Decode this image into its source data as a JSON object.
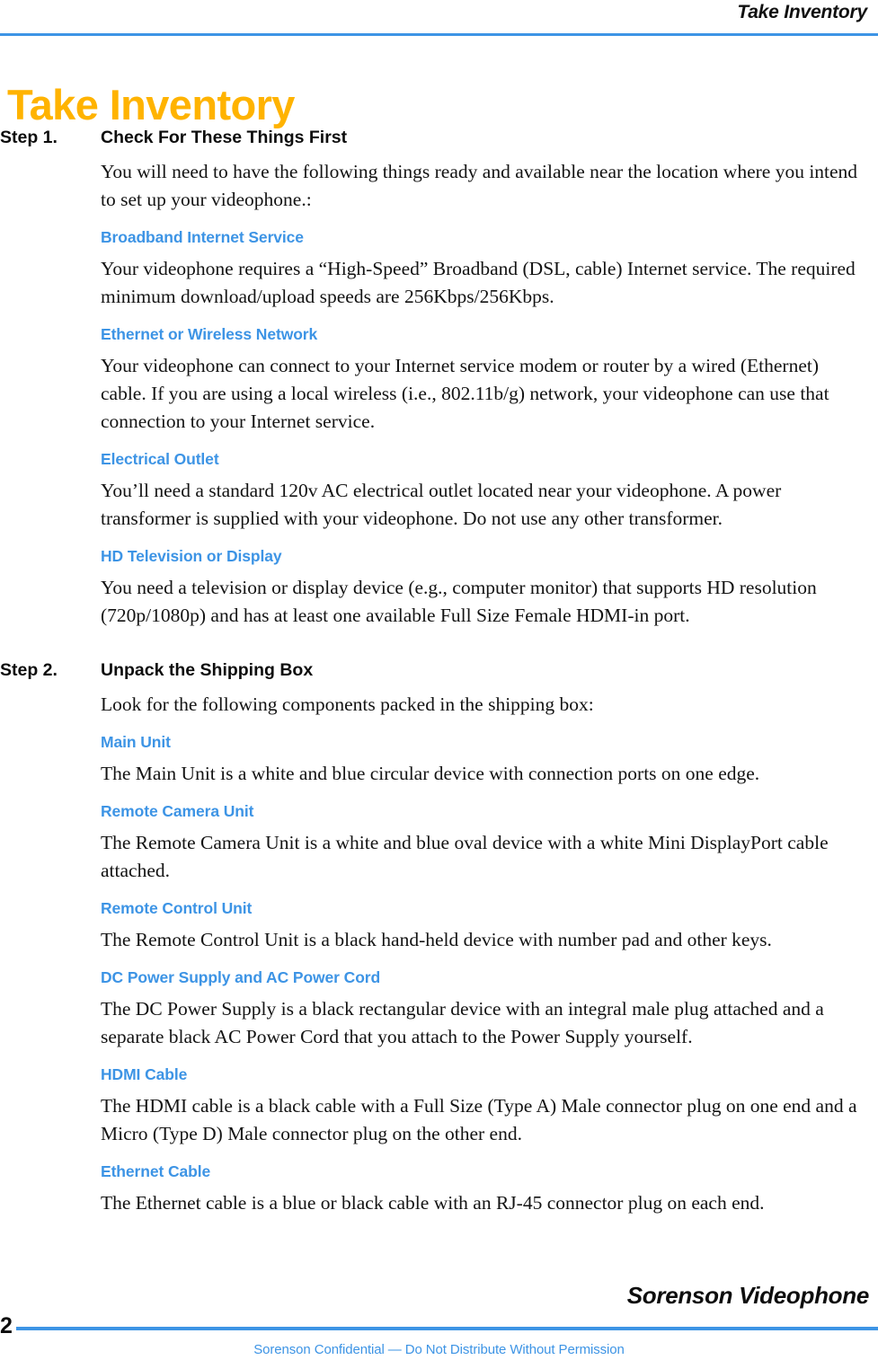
{
  "header": {
    "running_head": "Take Inventory",
    "rule_color": "#3d94e5"
  },
  "title": {
    "text": "Take Inventory",
    "color": "#ffb300"
  },
  "theme": {
    "accent_blue": "#3d94e5",
    "title_amber": "#ffb300",
    "body_text": "#131313"
  },
  "steps": [
    {
      "number": "Step 1.",
      "title": "Check For These Things First",
      "intro": "You will need to have the following things ready and available near the location where you intend to set up your videophone.:",
      "sections": [
        {
          "subhead": "Broadband Internet Service",
          "body": "Your videophone requires a “High-Speed” Broadband (DSL, cable) Internet service. The required minimum download/upload speeds are 256Kbps/256Kbps."
        },
        {
          "subhead": "Ethernet or Wireless Network",
          "body": "Your videophone can connect to your Internet service modem or router by a wired (Ethernet) cable. If you are using a local wireless (i.e., 802.11b/g) network, your videophone can use that connection to your Internet service."
        },
        {
          "subhead": "Electrical Outlet",
          "body": "You’ll need a standard 120v AC electrical outlet located near your videophone. A power transformer is supplied with your videophone. Do not use any other transformer."
        },
        {
          "subhead": "HD Television or Display",
          "body": "You need a television or display device (e.g., computer monitor) that supports HD resolution (720p/1080p) and has at least one available Full Size Female HDMI-in port."
        }
      ]
    },
    {
      "number": "Step 2.",
      "title": "Unpack the Shipping Box",
      "intro": "Look for the following components packed in the shipping box:",
      "sections": [
        {
          "subhead": "Main Unit",
          "body": "The Main Unit is a white and blue circular device with connection ports on one edge."
        },
        {
          "subhead": "Remote Camera Unit",
          "body": "The Remote Camera Unit is a white and blue oval device with a white Mini DisplayPort cable attached."
        },
        {
          "subhead": "Remote Control Unit",
          "body": "The Remote Control Unit is a black hand-held device with number pad and other keys."
        },
        {
          "subhead": "DC Power Supply and AC Power Cord",
          "body": "The DC Power Supply is a black rectangular device with an integral male plug attached and a separate black AC Power Cord that you attach to the Power Supply yourself."
        },
        {
          "subhead": "HDMI Cable",
          "body": "The HDMI cable is a black cable with a Full Size (Type A) Male connector plug on one end and a Micro (Type D) Male connector plug on the other end."
        },
        {
          "subhead": "Ethernet Cable",
          "body": "The Ethernet cable is a blue or black cable with an RJ-45 connector plug on each end."
        }
      ]
    }
  ],
  "footer": {
    "brand": "Sorenson Videophone",
    "page_number": "2",
    "confidential": "Sorenson Confidential — Do Not Distribute Without Permission",
    "rule_color": "#3d94e5"
  }
}
